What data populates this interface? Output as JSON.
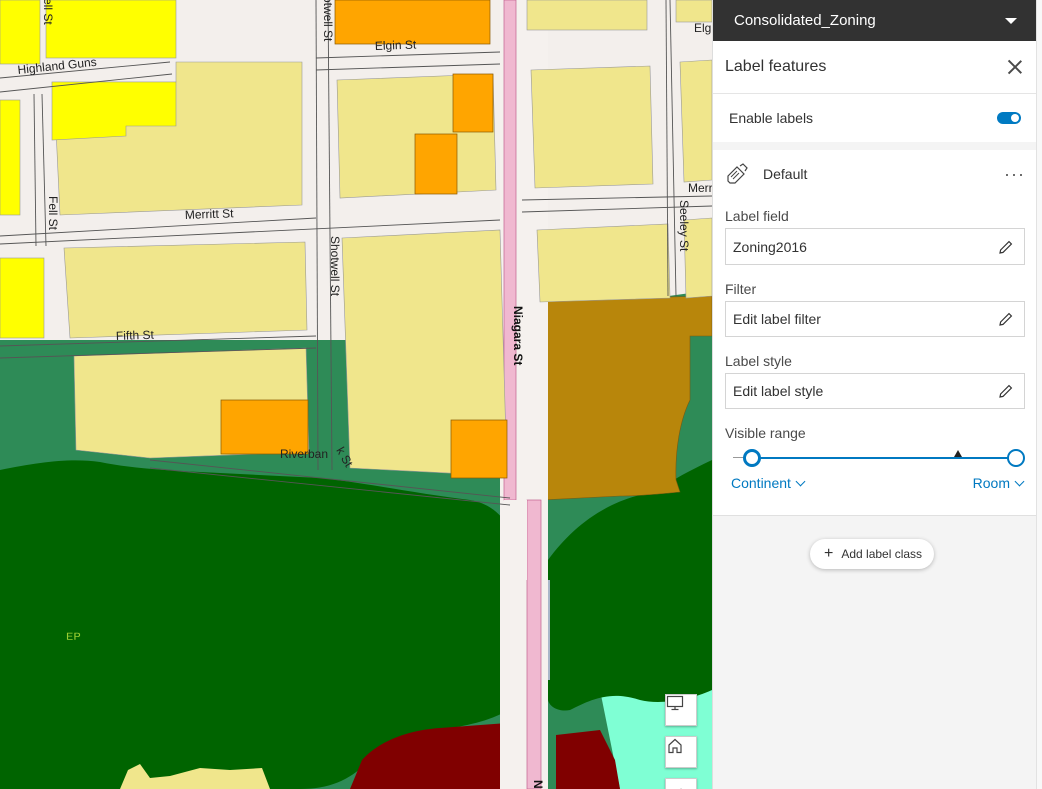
{
  "map": {
    "streets": {
      "highland": "Highland Guns",
      "elgin": "Elgin St",
      "fell_left": "Fell St",
      "fell_top": "ell St",
      "merritt": "Merritt St",
      "shotwell_top": "otwell St",
      "shotwell": "Shotwell St",
      "niagara": "Niagara St",
      "seeley": "Seeley St",
      "fifth": "Fifth St",
      "riverban": "Riverban",
      "riverban_tail": "k St",
      "elgin_right": "Elgin St",
      "merr_right": "Merr",
      "niagara_bottom": "N"
    },
    "zone_label_ep": "EP"
  },
  "panel": {
    "layer_name": "Consolidated_Zoning",
    "title": "Label features",
    "enable_labels": "Enable labels",
    "enable_labels_on": true,
    "label_class": {
      "name": "Default",
      "label_field_title": "Label field",
      "label_field_value": "Zoning2016",
      "filter_title": "Filter",
      "filter_value": "Edit label filter",
      "style_title": "Label style",
      "style_value": "Edit label style",
      "range_title": "Visible range",
      "range_min": "Continent",
      "range_max": "Room"
    },
    "add_label_class": "Add label class"
  },
  "colors": {
    "accent": "#0079c1",
    "header_bg": "#323232",
    "zone_yellow": "#ffff00",
    "zone_tan": "#f0e68c",
    "zone_orange": "#ffa500",
    "zone_brown": "#b8860b",
    "zone_darkgreen": "#006400",
    "zone_green": "#2e8b57",
    "zone_maroon": "#800000",
    "zone_aqua": "#7fffd4",
    "street_pink": "#f0b8d0"
  },
  "icons": [
    "chevron-down-icon",
    "close-icon",
    "label-pen-icon",
    "more-icon",
    "pencil-icon",
    "plus-icon",
    "monitor-icon",
    "home-icon"
  ]
}
